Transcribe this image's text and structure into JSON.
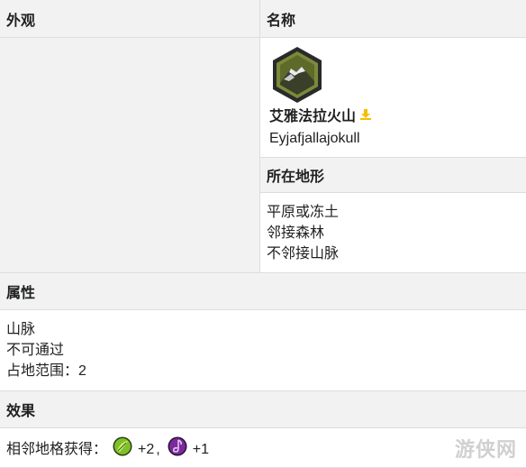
{
  "headers": {
    "appearance": "外观",
    "name": "名称",
    "terrain": "所在地形",
    "attributes": "属性",
    "effects": "效果"
  },
  "wonder": {
    "name_cn": "艾雅法拉火山",
    "name_en": "Eyjafjallajokull",
    "download_icon": "download-icon"
  },
  "terrain_lines": [
    "平原或冻土",
    "邻接森林",
    "不邻接山脉"
  ],
  "attribute_lines": [
    "山脉",
    "不可通过",
    "占地范围：2"
  ],
  "effects": {
    "prefix": "相邻地格获得：",
    "food_icon": "food-icon",
    "food_value": "+2",
    "separator": ",",
    "culture_icon": "culture-icon",
    "culture_value": "+1"
  },
  "watermark": "游侠网",
  "colors": {
    "header_bg": "#f2f2f2",
    "border": "#dddddd",
    "hex_frame": "#2a2a2a",
    "hex_inner": "#7a8a3a",
    "download_icon": "#f2c000",
    "food_icon": "#7ec12a",
    "culture_icon": "#7a2a9a"
  }
}
